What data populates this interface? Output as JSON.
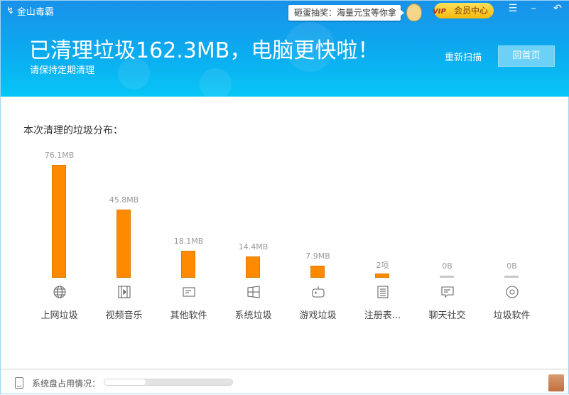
{
  "app": {
    "name": "金山毒霸"
  },
  "promo": {
    "text": "砸蛋抽奖：海量元宝等你拿"
  },
  "vip": {
    "tag": "VIP",
    "label": "会员中心"
  },
  "window": {
    "menu": "☰",
    "minimize": "–",
    "close": "↶"
  },
  "result": {
    "title": "已清理垃圾162.3MB，电脑更快啦！",
    "subtitle": "请保持定期清理",
    "rescan": "重新扫描",
    "home": "回首页"
  },
  "section_title": "本次清理的垃圾分布：",
  "categories": [
    {
      "label": "上网垃圾",
      "value_text": "76.1MB",
      "value": 76.1,
      "icon": "globe-icon"
    },
    {
      "label": "视频音乐",
      "value_text": "45.8MB",
      "value": 45.8,
      "icon": "film-icon"
    },
    {
      "label": "其他软件",
      "value_text": "18.1MB",
      "value": 18.1,
      "icon": "window-icon"
    },
    {
      "label": "系统垃圾",
      "value_text": "14.4MB",
      "value": 14.4,
      "icon": "windows-logo-icon"
    },
    {
      "label": "游戏垃圾",
      "value_text": "7.9MB",
      "value": 7.9,
      "icon": "gamepad-icon"
    },
    {
      "label": "注册表...",
      "value_text": "2项",
      "value": 2,
      "icon": "list-icon"
    },
    {
      "label": "聊天社交",
      "value_text": "0B",
      "value": 0,
      "icon": "chat-icon"
    },
    {
      "label": "垃圾软件",
      "value_text": "0B",
      "value": 0,
      "icon": "disc-icon"
    }
  ],
  "footer": {
    "disk_label": "系统盘占用情况：",
    "disk_usage_percent": 32
  },
  "colors": {
    "bar": "#ff8a00",
    "empty_bar": "#c8c8c8"
  }
}
